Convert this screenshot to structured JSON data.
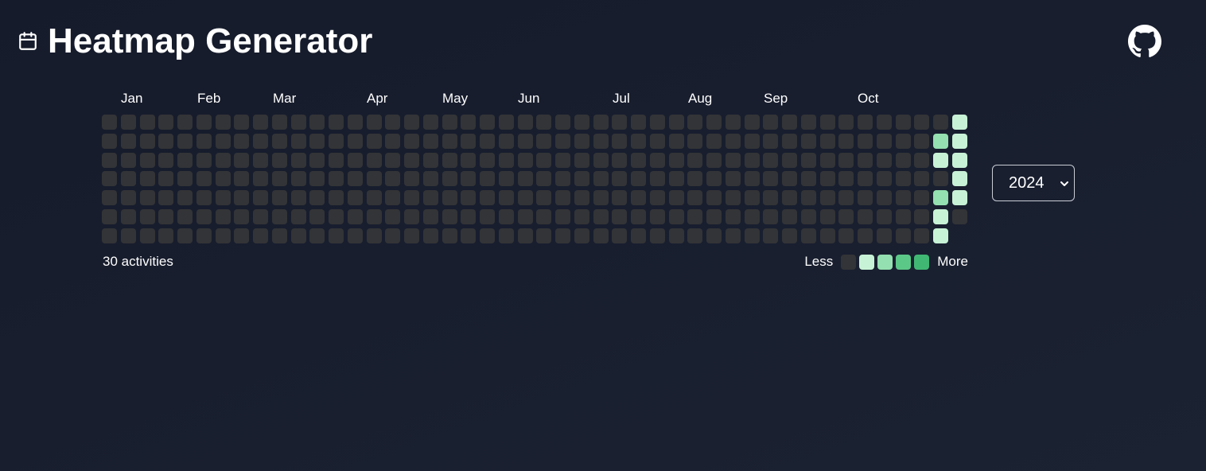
{
  "header": {
    "title": "Heatmap Generator",
    "calendar_icon": "calendar-icon",
    "github_icon": "github-icon"
  },
  "heatmap": {
    "months": [
      "Jan",
      "Feb",
      "Mar",
      "Apr",
      "May",
      "Jun",
      "Jul",
      "Aug",
      "Sep",
      "Oct"
    ],
    "activity_summary": "30 activities",
    "legend": {
      "less_label": "Less",
      "more_label": "More",
      "levels": [
        "#333437",
        "#c8f2d6",
        "#94e0b0",
        "#5cc888",
        "#40b873"
      ]
    },
    "weeks": 46,
    "days_per_week": 7,
    "active_cells": [
      {
        "week": 44,
        "day": 1,
        "level": 2
      },
      {
        "week": 44,
        "day": 2,
        "level": 1
      },
      {
        "week": 44,
        "day": 4,
        "level": 2
      },
      {
        "week": 44,
        "day": 5,
        "level": 1
      },
      {
        "week": 44,
        "day": 6,
        "level": 1
      },
      {
        "week": 45,
        "day": 0,
        "level": 1
      },
      {
        "week": 45,
        "day": 1,
        "level": 1
      },
      {
        "week": 45,
        "day": 2,
        "level": 1
      },
      {
        "week": 45,
        "day": 3,
        "level": 1
      },
      {
        "week": 45,
        "day": 4,
        "level": 1
      }
    ],
    "hidden_cells": [
      {
        "week": 45,
        "day": 6
      }
    ]
  },
  "year_select": {
    "value": "2024",
    "options": [
      "2024"
    ]
  }
}
